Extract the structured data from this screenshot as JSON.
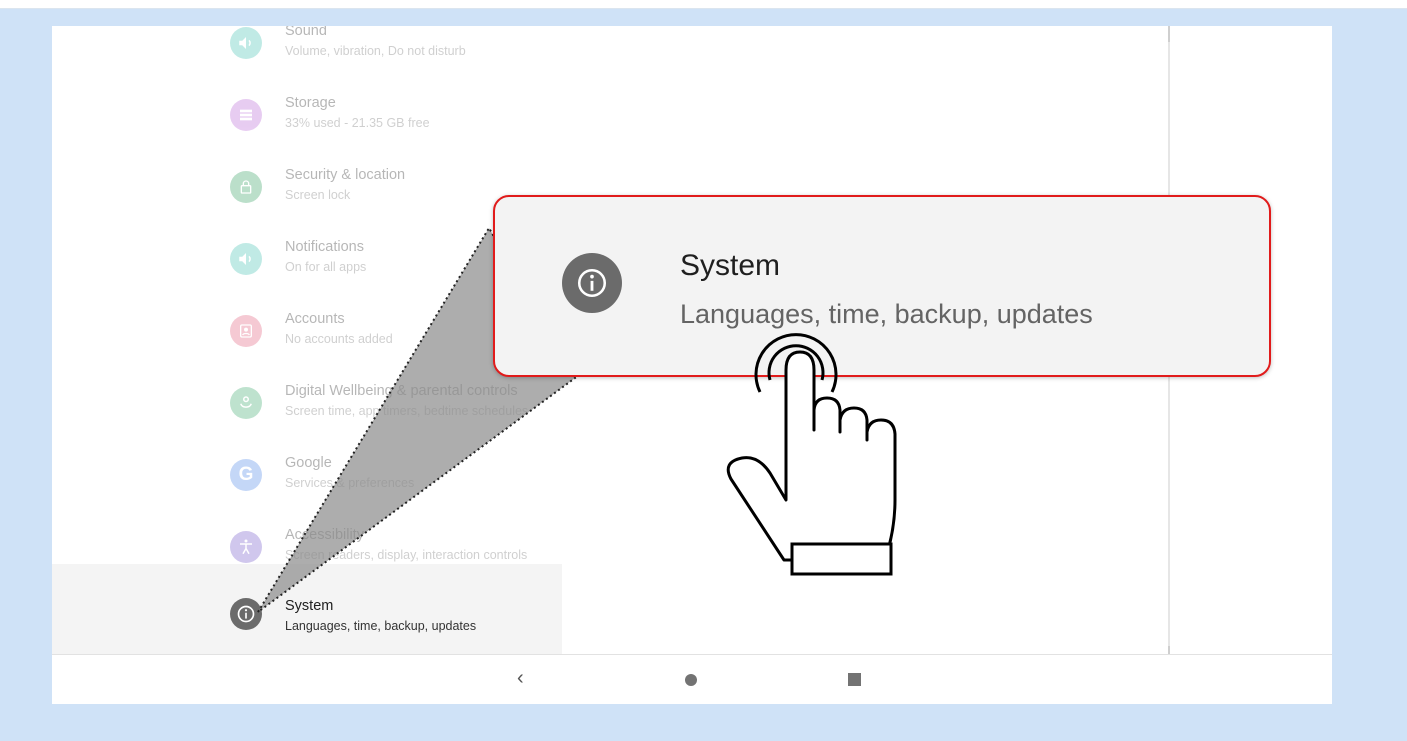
{
  "settings": {
    "items": [
      {
        "title": "Sound",
        "subtitle": "Volume, vibration, Do not disturb",
        "color": "#3fc1b0",
        "icon": "volume-icon"
      },
      {
        "title": "Storage",
        "subtitle": "33% used - 21.35 GB free",
        "color": "#b764d6",
        "icon": "storage-icon"
      },
      {
        "title": "Security & location",
        "subtitle": "Screen lock",
        "color": "#2f9e5c",
        "icon": "lock-icon"
      },
      {
        "title": "Notifications",
        "subtitle": "On for all apps",
        "color": "#3fc1b0",
        "icon": "bell-icon"
      },
      {
        "title": "Accounts",
        "subtitle": "No accounts added",
        "color": "#e15a78",
        "icon": "account-icon"
      },
      {
        "title": "Digital Wellbeing & parental controls",
        "subtitle": "Screen time, app timers, bedtime schedules",
        "color": "#37a86a",
        "icon": "wellbeing-icon"
      },
      {
        "title": "Google",
        "subtitle": "Services & preferences",
        "color": "#4a84e8",
        "icon": "google-icon"
      },
      {
        "title": "Accessibility",
        "subtitle": "Screen readers, display, interaction controls",
        "color": "#6f55c9",
        "icon": "accessibility-icon"
      },
      {
        "title": "System",
        "subtitle": "Languages, time, backup, updates",
        "color": "#6b6b6b",
        "icon": "info-icon"
      }
    ]
  },
  "callout": {
    "title": "System",
    "subtitle": "Languages, time, backup, updates",
    "border_color": "#e11b1b"
  },
  "navbar": {
    "back_glyph": "‹"
  }
}
